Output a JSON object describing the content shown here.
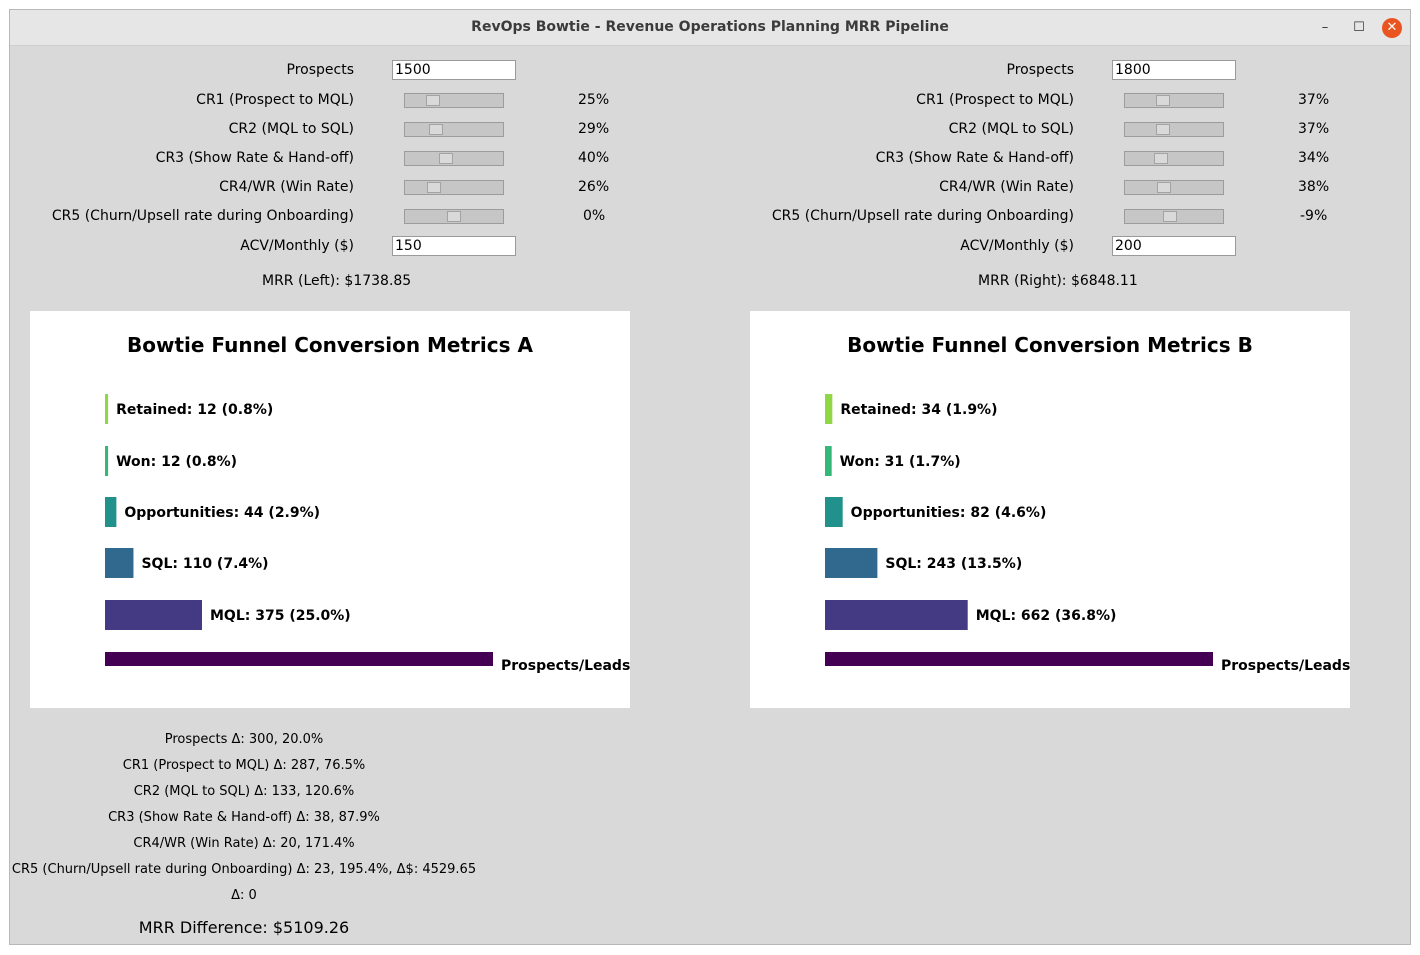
{
  "window": {
    "title": "RevOps Bowtie - Revenue Operations Planning MRR Pipeline",
    "controls": [
      "–",
      "☐",
      "✕"
    ]
  },
  "left": {
    "prospects_label": "Prospects",
    "prospects_value": "1500",
    "sliders": [
      {
        "label": "CR1 (Prospect to MQL)",
        "value": "25%",
        "level": 0.25
      },
      {
        "label": "CR2 (MQL to SQL)",
        "value": "29%",
        "level": 0.29
      },
      {
        "label": "CR3 (Show Rate & Hand-off)",
        "value": "40%",
        "level": 0.4
      },
      {
        "label": "CR4/WR (Win Rate)",
        "value": "26%",
        "level": 0.26
      },
      {
        "label": "CR5 (Churn/Upsell rate during Onboarding)",
        "value": "0%",
        "level": 0.5
      }
    ],
    "acv_label": "ACV/Monthly ($)",
    "acv_value": "150",
    "mrr": "MRR (Left): $1738.85"
  },
  "right": {
    "prospects_label": "Prospects",
    "prospects_value": "1800",
    "sliders": [
      {
        "label": "CR1 (Prospect to MQL)",
        "value": "37%",
        "level": 0.37
      },
      {
        "label": "CR2 (MQL to SQL)",
        "value": "37%",
        "level": 0.37
      },
      {
        "label": "CR3 (Show Rate & Hand-off)",
        "value": "34%",
        "level": 0.34
      },
      {
        "label": "CR4/WR (Win Rate)",
        "value": "38%",
        "level": 0.38
      },
      {
        "label": "CR5 (Churn/Upsell rate during Onboarding)",
        "value": "-9%",
        "level": 0.455
      }
    ],
    "acv_label": "ACV/Monthly ($)",
    "acv_value": "200",
    "mrr": "MRR (Right): $6848.11"
  },
  "chart_data": [
    {
      "type": "bar",
      "orientation": "horizontal",
      "title": "Bowtie Funnel Conversion Metrics A",
      "categories": [
        "Prospects/Leads",
        "MQL",
        "SQL",
        "Opportunities",
        "Won",
        "Retained"
      ],
      "values": [
        1500,
        375,
        110,
        44,
        12,
        12
      ],
      "labels": [
        "Prospects/Leads",
        "MQL: 375 (25.0%)",
        "SQL: 110 (7.4%)",
        "Opportunities: 44 (2.9%)",
        "Won: 12 (0.8%)",
        "Retained: 12 (0.8%)"
      ],
      "colors": [
        "#440154",
        "#443a83",
        "#31688e",
        "#21918c",
        "#35b779",
        "#8fd744"
      ],
      "xlim": [
        0,
        1500
      ]
    },
    {
      "type": "bar",
      "orientation": "horizontal",
      "title": "Bowtie Funnel Conversion Metrics B",
      "categories": [
        "Prospects/Leads",
        "MQL",
        "SQL",
        "Opportunities",
        "Won",
        "Retained"
      ],
      "values": [
        1800,
        662,
        243,
        82,
        31,
        34
      ],
      "labels": [
        "Prospects/Leads",
        "MQL: 662 (36.8%)",
        "SQL: 243 (13.5%)",
        "Opportunities: 82 (4.6%)",
        "Won: 31 (1.7%)",
        "Retained: 34 (1.9%)"
      ],
      "colors": [
        "#440154",
        "#443a83",
        "#31688e",
        "#21918c",
        "#35b779",
        "#8fd744"
      ],
      "xlim": [
        0,
        1800
      ]
    }
  ],
  "deltas": [
    "Prospects Δ: 300, 20.0%",
    "CR1 (Prospect to MQL) Δ: 287, 76.5%",
    "CR2 (MQL to SQL) Δ: 133, 120.6%",
    "CR3 (Show Rate & Hand-off) Δ: 38, 87.9%",
    "CR4/WR (Win Rate) Δ: 20, 171.4%",
    "CR5 (Churn/Upsell rate during Onboarding) Δ: 23, 195.4%, Δ$: 4529.65",
    "Δ: 0"
  ],
  "mrr_difference": "MRR Difference: $5109.26"
}
